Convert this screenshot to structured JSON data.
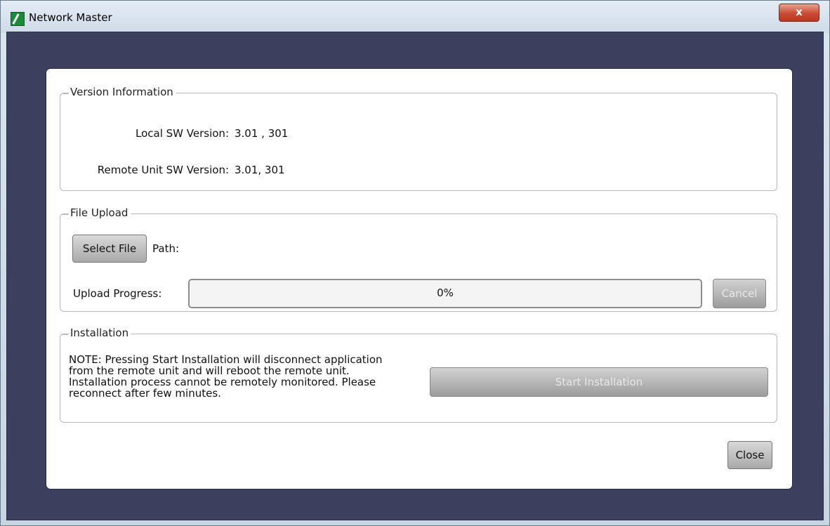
{
  "window": {
    "title": "Network Master",
    "close_glyph": "x"
  },
  "version_info": {
    "title": "Version Information",
    "local_label": "Local SW Version:",
    "local_value": "3.01 , 301",
    "remote_label": "Remote Unit SW Version:",
    "remote_value": "3.01, 301"
  },
  "file_upload": {
    "title": "File Upload",
    "select_file_label": "Select File",
    "path_label": "Path:",
    "path_value": "",
    "progress_label": "Upload Progress:",
    "progress_text": "0%",
    "progress_value": 0,
    "cancel_label": "Cancel"
  },
  "installation": {
    "title": "Installation",
    "note": "NOTE: Pressing Start Installation will disconnect application from the remote unit and will reboot the remote unit. Installation process cannot be remotely monitored. Please reconnect after few minutes.",
    "start_label": "Start Installation"
  },
  "footer": {
    "close_label": "Close"
  }
}
